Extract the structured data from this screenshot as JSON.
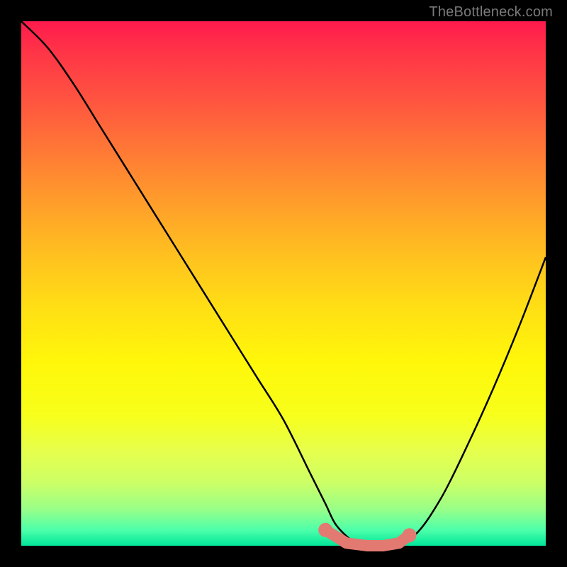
{
  "watermark": "TheBottleneck.com",
  "colors": {
    "background": "#000000",
    "gradient_top": "#ff1a4d",
    "gradient_bottom": "#00e699",
    "curve": "#000000",
    "markers": "#e27a72"
  },
  "chart_data": {
    "type": "line",
    "title": "",
    "xlabel": "",
    "ylabel": "",
    "xlim": [
      0,
      100
    ],
    "ylim": [
      0,
      100
    ],
    "x": [
      0,
      5,
      10,
      15,
      20,
      25,
      30,
      35,
      40,
      45,
      50,
      55,
      58,
      60,
      63,
      65,
      68,
      70,
      75,
      80,
      85,
      90,
      95,
      100
    ],
    "values": [
      100,
      95,
      88,
      80,
      72,
      64,
      56,
      48,
      40,
      32,
      24,
      14,
      8,
      4,
      1,
      0,
      0,
      0,
      2,
      9,
      19,
      30,
      42,
      55
    ],
    "series": [
      {
        "name": "bottleneck-curve",
        "x": [
          0,
          5,
          10,
          15,
          20,
          25,
          30,
          35,
          40,
          45,
          50,
          55,
          58,
          60,
          63,
          65,
          68,
          70,
          75,
          80,
          85,
          90,
          95,
          100
        ],
        "values": [
          100,
          95,
          88,
          80,
          72,
          64,
          56,
          48,
          40,
          32,
          24,
          14,
          8,
          4,
          1,
          0,
          0,
          0,
          2,
          9,
          19,
          30,
          42,
          55
        ]
      }
    ],
    "markers": [
      {
        "x": 58,
        "y": 3
      },
      {
        "x": 62,
        "y": 0.5
      },
      {
        "x": 66,
        "y": 0
      },
      {
        "x": 69,
        "y": 0
      },
      {
        "x": 72,
        "y": 0.5
      },
      {
        "x": 74,
        "y": 2
      }
    ],
    "annotations": []
  }
}
